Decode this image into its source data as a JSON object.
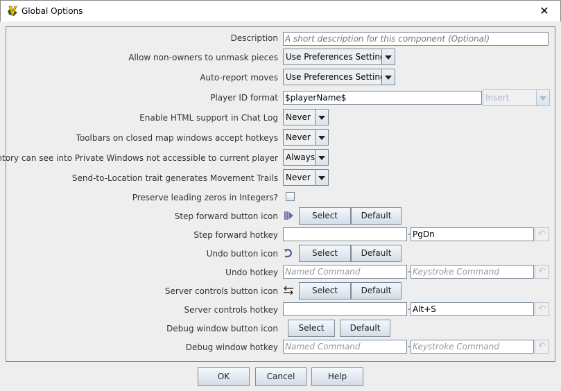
{
  "window": {
    "title": "Global Options",
    "close": "✕"
  },
  "rows": {
    "description": {
      "label": "Description",
      "placeholder": "A short description for this component (Optional)"
    },
    "unmask": {
      "label": "Allow non-owners to unmask pieces",
      "value": "Use Preferences Setting"
    },
    "autoreport": {
      "label": "Auto-report moves",
      "value": "Use Preferences Setting"
    },
    "playerid": {
      "label": "Player ID format",
      "value": "$playerName$",
      "insert": "Insert"
    },
    "html": {
      "label": "Enable HTML support in Chat Log",
      "value": "Never"
    },
    "toolbars": {
      "label": "Toolbars on closed map windows accept hotkeys",
      "value": "Never"
    },
    "inventory": {
      "label": "Inventory can see into Private Windows not accessible to current player",
      "value": "Always"
    },
    "trails": {
      "label": "Send-to-Location trait generates Movement Trails",
      "value": "Never"
    },
    "zeros": {
      "label": "Preserve leading zeros in Integers?",
      "checked": false
    },
    "step_icon": {
      "label": "Step forward button icon",
      "icon": "step-forward-icon"
    },
    "step_hotkey": {
      "label": "Step forward hotkey",
      "named": "",
      "keystroke": "PgDn"
    },
    "undo_icon": {
      "label": "Undo button icon",
      "icon": "undo-icon"
    },
    "undo_hotkey": {
      "label": "Undo hotkey",
      "named_placeholder": "Named Command",
      "keystroke_placeholder": "Keystroke Command"
    },
    "server_icon": {
      "label": "Server controls button icon",
      "icon": "server-arrows-icon"
    },
    "server_hotkey": {
      "label": "Server controls hotkey",
      "named": "",
      "keystroke": "Alt+S"
    },
    "debug_icon": {
      "label": "Debug window button icon"
    },
    "debug_hotkey": {
      "label": "Debug window hotkey",
      "named_placeholder": "Named Command",
      "keystroke_placeholder": "Keystroke Command"
    }
  },
  "labels": {
    "select": "Select",
    "default": "Default",
    "dash": "-",
    "revert": "↶"
  },
  "footer": {
    "ok": "OK",
    "cancel": "Cancel",
    "help": "Help"
  }
}
